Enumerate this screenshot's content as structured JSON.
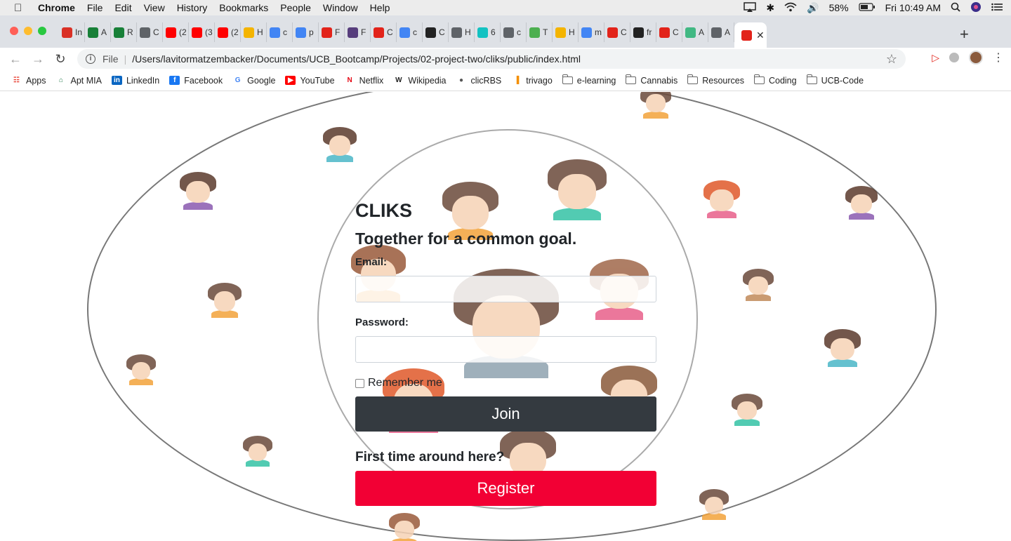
{
  "menubar": {
    "app": "Chrome",
    "items": [
      "File",
      "Edit",
      "View",
      "History",
      "Bookmarks",
      "People",
      "Window",
      "Help"
    ],
    "battery": "58%",
    "clock": "Fri 10:49 AM"
  },
  "tabs": [
    {
      "label": "In",
      "icon": "gmail-icon",
      "color": "#d93025"
    },
    {
      "label": "A",
      "icon": "sheets-icon",
      "color": "#188038"
    },
    {
      "label": "R",
      "icon": "sheets-icon",
      "color": "#188038"
    },
    {
      "label": "C",
      "icon": "globe-icon",
      "color": "#5f6368"
    },
    {
      "label": "(2",
      "icon": "youtube-icon",
      "color": "#ff0000"
    },
    {
      "label": "(3",
      "icon": "youtube-icon",
      "color": "#ff0000"
    },
    {
      "label": "(2",
      "icon": "youtube-icon",
      "color": "#ff0000"
    },
    {
      "label": "H",
      "icon": "slides-icon",
      "color": "#f4b400"
    },
    {
      "label": "c",
      "icon": "docs-icon",
      "color": "#4285f4"
    },
    {
      "label": "p",
      "icon": "google-icon",
      "color": "#4285f4"
    },
    {
      "label": "F",
      "icon": "bootcamp-icon",
      "color": "#e2231a"
    },
    {
      "label": "F",
      "icon": "bootstrap-icon",
      "color": "#563d7c"
    },
    {
      "label": "C",
      "icon": "bootcamp-icon",
      "color": "#e2231a"
    },
    {
      "label": "c",
      "icon": "google-icon",
      "color": "#4285f4"
    },
    {
      "label": "C",
      "icon": "codepen-icon",
      "color": "#222222"
    },
    {
      "label": "H",
      "icon": "globe-icon",
      "color": "#5f6368"
    },
    {
      "label": "6",
      "icon": "tinkercad-icon",
      "color": "#13c2c2"
    },
    {
      "label": "c",
      "icon": "globe-icon",
      "color": "#5f6368"
    },
    {
      "label": "T",
      "icon": "w3-icon",
      "color": "#4caf50"
    },
    {
      "label": "H",
      "icon": "slides-icon",
      "color": "#f4b400"
    },
    {
      "label": "m",
      "icon": "google-icon",
      "color": "#4285f4"
    },
    {
      "label": "C",
      "icon": "bootcamp-icon",
      "color": "#e2231a"
    },
    {
      "label": "fr",
      "icon": "github-icon",
      "color": "#222222"
    },
    {
      "label": "C",
      "icon": "bootcamp-icon",
      "color": "#e2231a"
    },
    {
      "label": "A",
      "icon": "vue-icon",
      "color": "#41b883"
    },
    {
      "label": "A",
      "icon": "globe-icon",
      "color": "#5f6368"
    }
  ],
  "active_tab": {
    "icon": "bootcamp-icon",
    "color": "#e2231a"
  },
  "address": {
    "scheme": "File",
    "url": "/Users/lavitormatzembacker/Documents/UCB_Bootcamp/Projects/02-project-two/cliks/public/index.html"
  },
  "bookmarks": [
    {
      "label": "Apps",
      "icon": "apps-grid-icon"
    },
    {
      "label": "Apt MIA",
      "icon": "building-icon"
    },
    {
      "label": "LinkedIn",
      "icon": "linkedin-icon"
    },
    {
      "label": "Facebook",
      "icon": "facebook-icon"
    },
    {
      "label": "Google",
      "icon": "google-icon"
    },
    {
      "label": "YouTube",
      "icon": "youtube-icon"
    },
    {
      "label": "Netflix",
      "icon": "netflix-icon"
    },
    {
      "label": "Wikipedia",
      "icon": "wikipedia-icon"
    },
    {
      "label": "clicRBS",
      "icon": "globe-icon"
    },
    {
      "label": "trivago",
      "icon": "trivago-icon"
    },
    {
      "label": "e-learning",
      "icon": "folder-icon"
    },
    {
      "label": "Cannabis",
      "icon": "folder-icon"
    },
    {
      "label": "Resources",
      "icon": "folder-icon"
    },
    {
      "label": "Coding",
      "icon": "folder-icon"
    },
    {
      "label": "UCB-Code",
      "icon": "folder-icon"
    }
  ],
  "login": {
    "brand": "CLIKS",
    "tagline": "Together for a common goal.",
    "email_label": "Email:",
    "email_value": "",
    "password_label": "Password:",
    "password_value": "",
    "remember_label": "Remember me",
    "join_label": "Join",
    "first_time": "First time around here?",
    "register_label": "Register"
  },
  "colors": {
    "join_button": "#343a40",
    "register_button": "#f20034",
    "text": "#212529"
  }
}
